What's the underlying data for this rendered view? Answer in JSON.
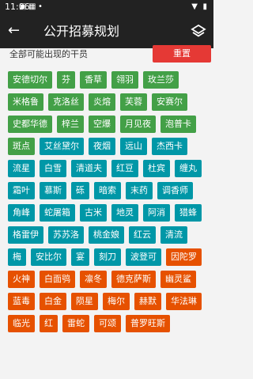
{
  "status": {
    "time": "11:06"
  },
  "appbar": {
    "title": "公开招募规划",
    "back_icon": "arrow-left-icon",
    "layers_icon": "layers-icon"
  },
  "subheader": {
    "label": "全部可能出现的干员",
    "reset_label": "重置"
  },
  "colors": {
    "green": "#43a047",
    "teal": "#0097a7",
    "orange": "#e65100",
    "red": "#e53935"
  },
  "chips": [
    {
      "label": "安德切尔",
      "color": "green"
    },
    {
      "label": "芬",
      "color": "green"
    },
    {
      "label": "香草",
      "color": "green"
    },
    {
      "label": "翎羽",
      "color": "green"
    },
    {
      "label": "玫兰莎",
      "color": "green"
    },
    {
      "label": "米格鲁",
      "color": "green"
    },
    {
      "label": "克洛丝",
      "color": "green"
    },
    {
      "label": "炎熔",
      "color": "green"
    },
    {
      "label": "芙蓉",
      "color": "green"
    },
    {
      "label": "安赛尔",
      "color": "green"
    },
    {
      "label": "史都华德",
      "color": "green"
    },
    {
      "label": "梓兰",
      "color": "green"
    },
    {
      "label": "空爆",
      "color": "green"
    },
    {
      "label": "月见夜",
      "color": "green"
    },
    {
      "label": "泡普卡",
      "color": "green"
    },
    {
      "label": "斑点",
      "color": "green"
    },
    {
      "label": "艾丝黛尔",
      "color": "teal"
    },
    {
      "label": "夜烟",
      "color": "teal"
    },
    {
      "label": "远山",
      "color": "teal"
    },
    {
      "label": "杰西卡",
      "color": "teal"
    },
    {
      "label": "流星",
      "color": "teal"
    },
    {
      "label": "白雪",
      "color": "teal"
    },
    {
      "label": "清道夫",
      "color": "teal"
    },
    {
      "label": "红豆",
      "color": "teal"
    },
    {
      "label": "杜宾",
      "color": "teal"
    },
    {
      "label": "缠丸",
      "color": "teal"
    },
    {
      "label": "霜叶",
      "color": "teal"
    },
    {
      "label": "慕斯",
      "color": "teal"
    },
    {
      "label": "砾",
      "color": "teal"
    },
    {
      "label": "暗索",
      "color": "teal"
    },
    {
      "label": "末药",
      "color": "teal"
    },
    {
      "label": "调香师",
      "color": "teal"
    },
    {
      "label": "角峰",
      "color": "teal"
    },
    {
      "label": "蛇屠箱",
      "color": "teal"
    },
    {
      "label": "古米",
      "color": "teal"
    },
    {
      "label": "地灵",
      "color": "teal"
    },
    {
      "label": "阿消",
      "color": "teal"
    },
    {
      "label": "猎蜂",
      "color": "teal"
    },
    {
      "label": "格雷伊",
      "color": "teal"
    },
    {
      "label": "苏苏洛",
      "color": "teal"
    },
    {
      "label": "桃金娘",
      "color": "teal"
    },
    {
      "label": "红云",
      "color": "teal"
    },
    {
      "label": "清流",
      "color": "teal"
    },
    {
      "label": "梅",
      "color": "teal"
    },
    {
      "label": "安比尔",
      "color": "teal"
    },
    {
      "label": "宴",
      "color": "teal"
    },
    {
      "label": "刻刀",
      "color": "teal"
    },
    {
      "label": "波登可",
      "color": "teal"
    },
    {
      "label": "因陀罗",
      "color": "orange"
    },
    {
      "label": "火神",
      "color": "orange"
    },
    {
      "label": "白面鸮",
      "color": "orange"
    },
    {
      "label": "凛冬",
      "color": "orange"
    },
    {
      "label": "德克萨斯",
      "color": "orange"
    },
    {
      "label": "幽灵鲨",
      "color": "orange"
    },
    {
      "label": "蓝毒",
      "color": "orange"
    },
    {
      "label": "白金",
      "color": "orange"
    },
    {
      "label": "陨星",
      "color": "orange"
    },
    {
      "label": "梅尔",
      "color": "orange"
    },
    {
      "label": "赫默",
      "color": "orange"
    },
    {
      "label": "华法琳",
      "color": "orange"
    },
    {
      "label": "临光",
      "color": "orange"
    },
    {
      "label": "红",
      "color": "orange"
    },
    {
      "label": "雷蛇",
      "color": "orange"
    },
    {
      "label": "可颂",
      "color": "orange"
    },
    {
      "label": "普罗旺斯",
      "color": "orange"
    }
  ]
}
